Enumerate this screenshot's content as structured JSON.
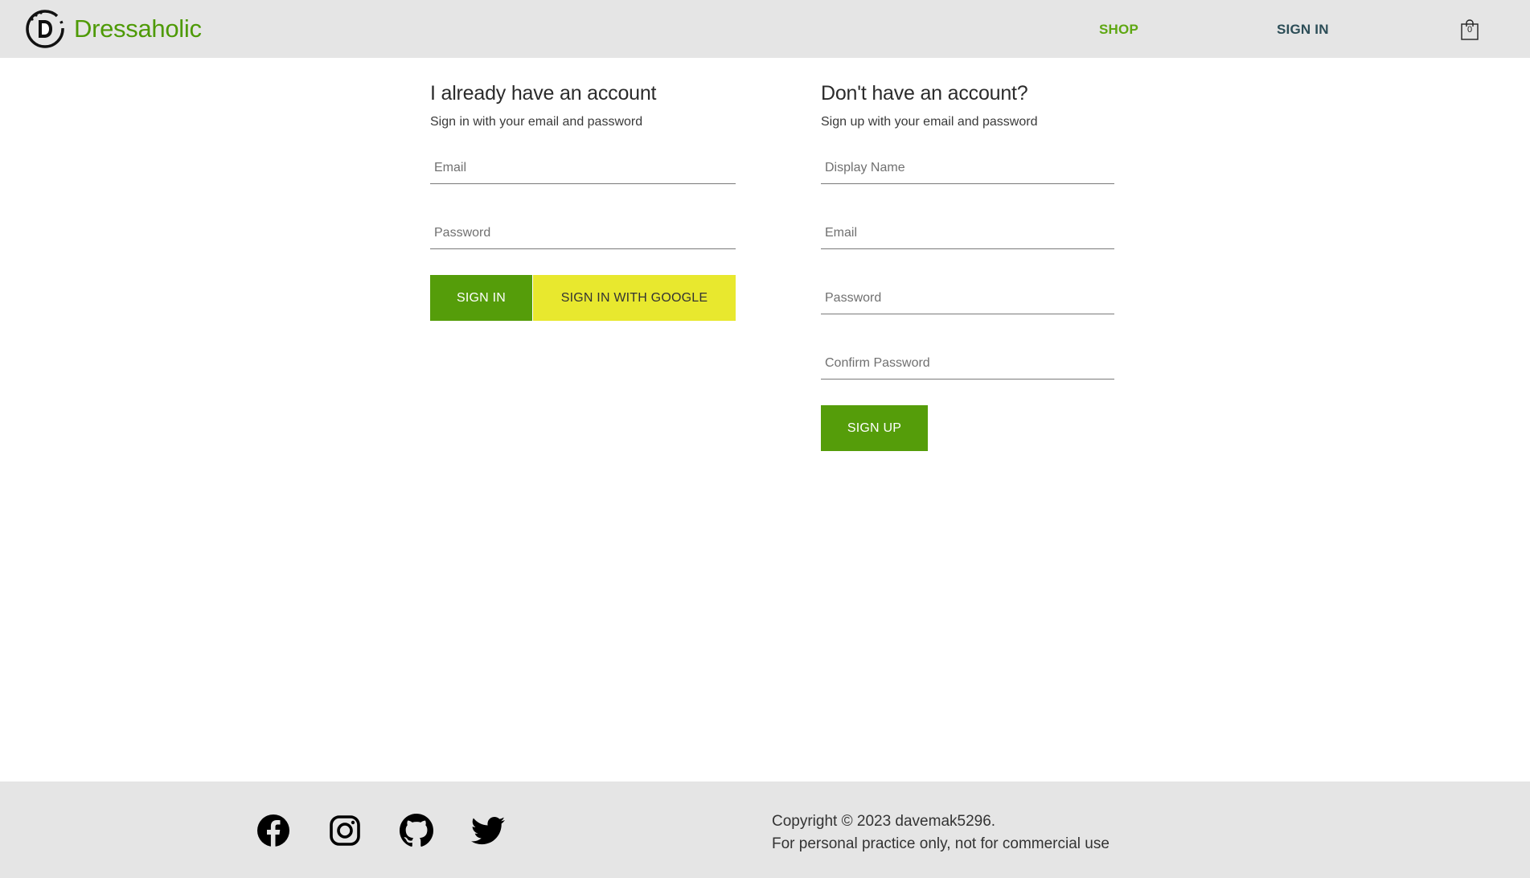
{
  "header": {
    "brand": "Dressaholic",
    "nav": {
      "shop": "SHOP",
      "sign_in": "SIGN IN"
    },
    "cart_count": "0",
    "brand_color": "#4e9a06"
  },
  "signin": {
    "title": "I already have an account",
    "subtitle": "Sign in with your email and password",
    "email_placeholder": "Email",
    "password_placeholder": "Password",
    "sign_in_button": "SIGN IN",
    "google_button": "SIGN IN WITH GOOGLE"
  },
  "signup": {
    "title": "Don't have an account?",
    "subtitle": "Sign up with your email and password",
    "display_name_placeholder": "Display Name",
    "email_placeholder": "Email",
    "password_placeholder": "Password",
    "confirm_password_placeholder": "Confirm Password",
    "sign_up_button": "SIGN UP"
  },
  "footer": {
    "social_icons": [
      "facebook-icon",
      "instagram-icon",
      "github-icon",
      "twitter-icon"
    ],
    "copyright": "Copyright © 2023 davemak5296.",
    "notice": "For personal practice only, not for commercial use"
  },
  "colors": {
    "header_bg": "#e5e5e5",
    "primary_button": "#559d0a",
    "google_button": "#e8e82e",
    "nav_shop": "#5ea712",
    "nav_sign_in": "#2c4d57"
  }
}
